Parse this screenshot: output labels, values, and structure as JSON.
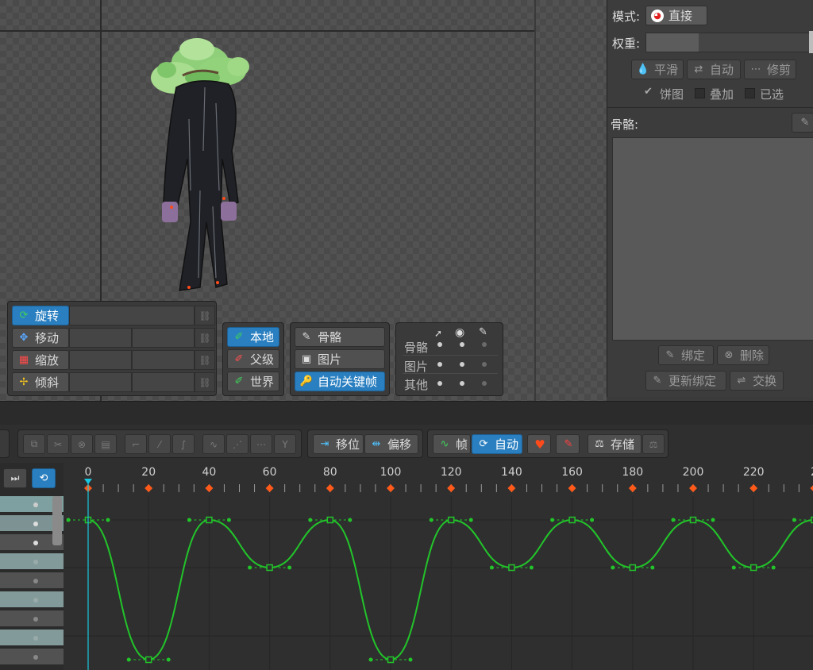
{
  "transform_panel": {
    "rotate_label": "旋转",
    "translate_label": "移动",
    "scale_label": "缩放",
    "shear_label": "倾斜"
  },
  "axes_panel": {
    "local_label": "本地",
    "parent_label": "父级",
    "world_label": "世界"
  },
  "key_panel": {
    "bones_label": "骨骼",
    "images_label": "图片",
    "autokey_label": "自动关键帧"
  },
  "visibility_panel": {
    "rows": [
      "骨骼",
      "图片",
      "其他"
    ]
  },
  "weights_panel": {
    "mode_label": "模式:",
    "mode_value": "直接",
    "weight_label": "权重:",
    "smooth_label": "平滑",
    "auto_label": "自动",
    "prune_label": "修剪",
    "pie_label": "饼图",
    "overlay_label": "叠加",
    "selected_label": "已选",
    "bones_label": "骨骼:",
    "bind_label": "绑定",
    "remove_label": "删除",
    "update_bind_label": "更新绑定",
    "swap_label": "交换"
  },
  "timeline_toolbar": {
    "shift_label": "移位",
    "offset_label": "偏移",
    "frame_label": "帧",
    "auto_label": "自动",
    "store_label": "存储"
  },
  "ruler": {
    "labels": [
      "0",
      "20",
      "40",
      "60",
      "80",
      "100",
      "120",
      "140",
      "160",
      "180",
      "200",
      "220",
      "2"
    ]
  },
  "colors": {
    "accent": "#2a7fc0",
    "curve": "#22c42a",
    "key": "#ff5a1a",
    "playhead": "#19c8e0"
  }
}
